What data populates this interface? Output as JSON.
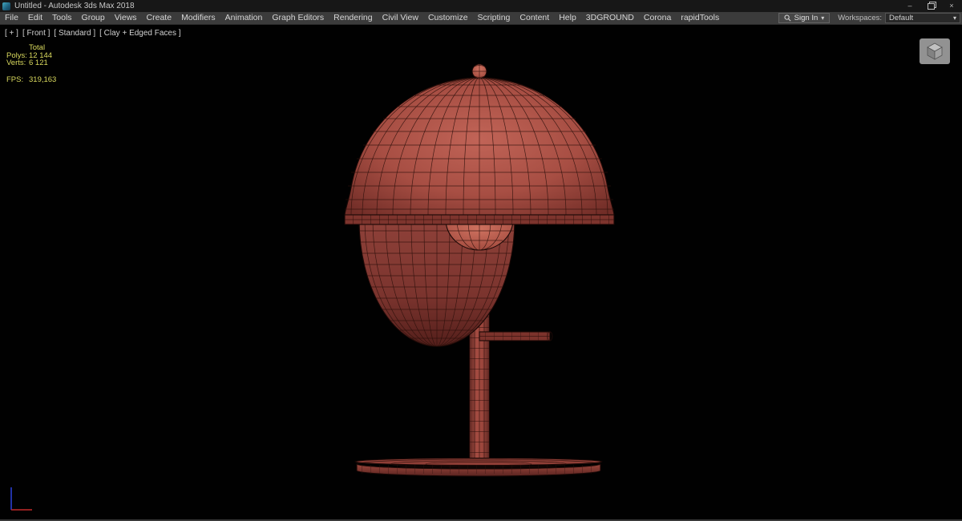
{
  "window": {
    "title": "Untitled - Autodesk 3ds Max 2018",
    "minimize_glyph": "–",
    "close_glyph": "×"
  },
  "menubar": {
    "items": [
      "File",
      "Edit",
      "Tools",
      "Group",
      "Views",
      "Create",
      "Modifiers",
      "Animation",
      "Graph Editors",
      "Rendering",
      "Civil View",
      "Customize",
      "Scripting",
      "Content",
      "Help",
      "3DGROUND",
      "Corona",
      "rapidTools"
    ],
    "signin_label": "Sign In",
    "workspaces_label": "Workspaces:",
    "workspace_value": "Default"
  },
  "icons": {
    "caret_down": "▾"
  },
  "viewport": {
    "label_segments": {
      "general_menu": "[ + ]",
      "pov": "[ Front ]",
      "style": "[ Standard ]",
      "shading": "[ Clay + Edged Faces ]"
    },
    "stats": {
      "total_header": "Total",
      "polys_label": "Polys:",
      "polys_value": "12 144",
      "verts_label": "Verts:",
      "verts_value": "6 121",
      "fps_label": "FPS:",
      "fps_value": "319,163"
    },
    "colors": {
      "clay": "#a74e43",
      "edges": "#2e100c",
      "background": "#000000",
      "stats_text": "#dada5e",
      "axis_x": "#c22a2a",
      "axis_z": "#2b3fd0"
    }
  }
}
